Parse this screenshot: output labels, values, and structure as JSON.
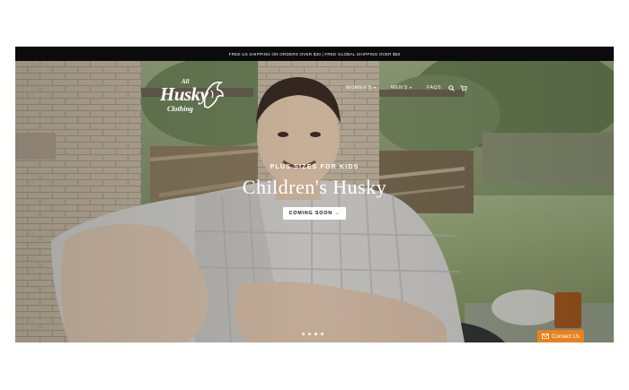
{
  "announcement": "FREE US SHIPPING ON ORDERS OVER $30 | FREE GLOBAL SHIPPING OVER $50",
  "logo": {
    "line1": "All",
    "line2": "Husky",
    "line3": "Clothing"
  },
  "nav": {
    "items": [
      {
        "label": "WOMEN'S",
        "has_dropdown": true
      },
      {
        "label": "MEN'S",
        "has_dropdown": true
      },
      {
        "label": "FAQS",
        "has_dropdown": false
      }
    ],
    "icons": [
      "search-icon",
      "cart-icon"
    ]
  },
  "hero": {
    "subtitle": "PLUS SIZES FOR KIDS",
    "title": "Children's Husky",
    "cta": "COMING SOON",
    "cta_arrow": "→",
    "slides_total": 4,
    "slide_active": 3
  },
  "contact": {
    "label": "Contact Us",
    "icon": "envelope-icon",
    "color": "#e8811e"
  }
}
